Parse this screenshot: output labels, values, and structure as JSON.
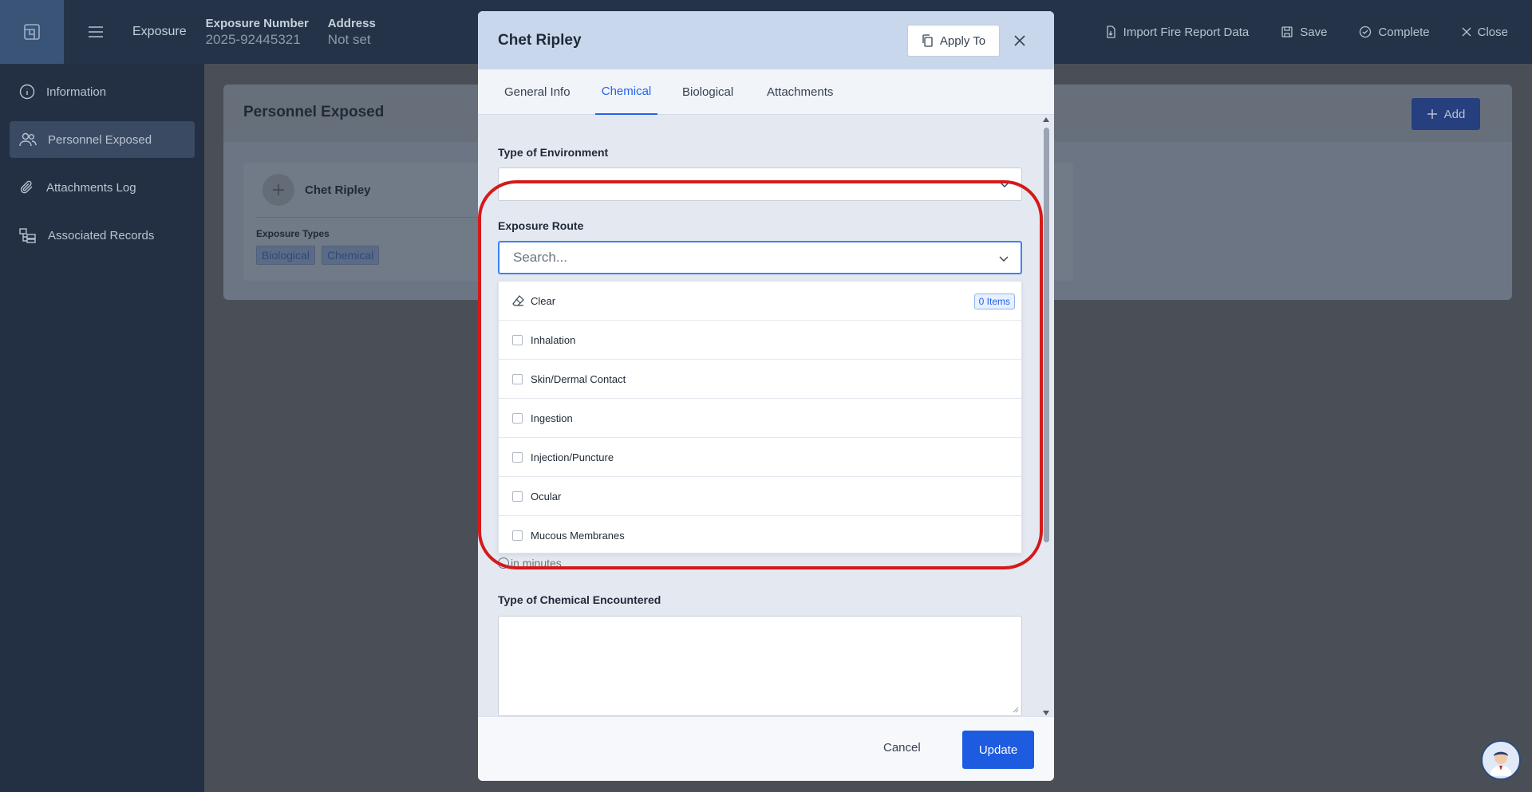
{
  "topbar": {
    "crumb": "Exposure",
    "exposure_number_label": "Exposure Number",
    "exposure_number_value": "2025-92445321",
    "address_label": "Address",
    "address_value": "Not set",
    "actions": {
      "import": "Import Fire Report Data",
      "save": "Save",
      "complete": "Complete",
      "close": "Close"
    }
  },
  "sidebar": {
    "items": [
      {
        "label": "Information",
        "icon": "info-icon"
      },
      {
        "label": "Personnel Exposed",
        "icon": "users-icon",
        "active": true
      },
      {
        "label": "Attachments Log",
        "icon": "paperclip-icon"
      },
      {
        "label": "Associated Records",
        "icon": "folder-tree-icon"
      }
    ]
  },
  "main": {
    "title": "Personnel Exposed",
    "add_label": "Add",
    "person": {
      "name": "Chet Ripley",
      "exposure_types_label": "Exposure Types",
      "tags": [
        "Biological",
        "Chemical"
      ]
    }
  },
  "modal": {
    "title": "Chet Ripley",
    "apply_to": "Apply To",
    "tabs": [
      "General Info",
      "Chemical",
      "Biological",
      "Attachments"
    ],
    "active_tab": "Chemical",
    "type_of_environment_label": "Type of Environment",
    "exposure_route_label": "Exposure Route",
    "search_placeholder": "Search...",
    "dropdown": {
      "clear_label": "Clear",
      "items_badge": "0 Items",
      "options": [
        "Inhalation",
        "Skin/Dermal Contact",
        "Ingestion",
        "Injection/Puncture",
        "Ocular",
        "Mucous Membranes"
      ]
    },
    "minutes_note": "in minutes",
    "chemical_label": "Type of Chemical Encountered",
    "cancel": "Cancel",
    "update": "Update"
  },
  "colors": {
    "accent": "#2563eb",
    "annotation": "#d41a1a"
  }
}
